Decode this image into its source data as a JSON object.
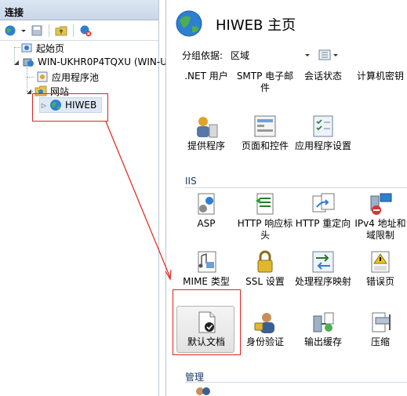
{
  "left_panel": {
    "header": "连接",
    "tree": [
      {
        "label": "起始页"
      },
      {
        "label": "WIN-UKHR0P4TQXU (WIN-UK"
      },
      {
        "label": "应用程序池"
      },
      {
        "label": "网站"
      },
      {
        "label": "HIWEB"
      }
    ]
  },
  "right_panel": {
    "title": "HIWEB 主页",
    "group_by_label": "分组依据:",
    "group_by_value": "区域",
    "top_row": [
      ".NET 用户",
      "SMTP 电子邮件",
      "会话状态",
      "计算机密钥"
    ],
    "row2": [
      "提供程序",
      "页面和控件",
      "应用程序设置"
    ],
    "section_iis": "IIS",
    "iis_row1": [
      "ASP",
      "HTTP 响应标头",
      "HTTP 重定向",
      "IPv4 地址和域限制"
    ],
    "iis_row2": [
      "MIME 类型",
      "SSL 设置",
      "处理程序映射",
      "错误页"
    ],
    "iis_row3": [
      "默认文档",
      "身份验证",
      "输出缓存",
      "压缩"
    ],
    "section_manage": "管理"
  },
  "colors": {
    "annotation": "#e0241b",
    "section_text": "#1b3a66"
  }
}
